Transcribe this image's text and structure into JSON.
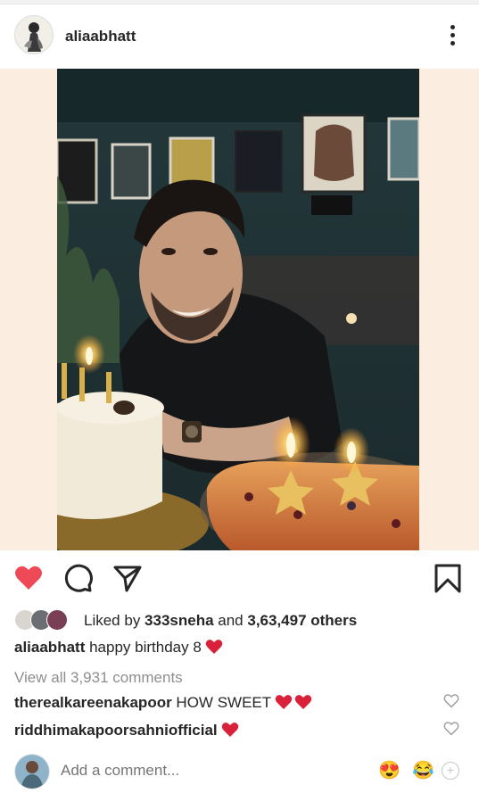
{
  "post": {
    "username": "aliaabhatt",
    "likes": {
      "prefix": "Liked by ",
      "user": "333sneha",
      "middle": " and ",
      "others": "3,63,497 others"
    },
    "caption": {
      "user": "aliaabhatt",
      "text": " happy birthday 8"
    },
    "view_all": "View all 3,931 comments",
    "comments": [
      {
        "user": "therealkareenakapoor",
        "text": " HOW SWEET"
      },
      {
        "user": "riddhimakapoorsahniofficial",
        "text": ""
      }
    ],
    "add_comment_placeholder": "Add a comment...",
    "emojis": [
      "😍",
      "😂"
    ]
  },
  "colors": {
    "like_red": "#ed4956",
    "text": "#262626",
    "muted": "#8e8e8e",
    "photo_margin": "#fbeee1"
  },
  "icons": [
    "more-icon",
    "heart-filled-icon",
    "comment-icon",
    "share-icon",
    "bookmark-icon",
    "heart-outline-icon",
    "plus-circle-icon"
  ]
}
